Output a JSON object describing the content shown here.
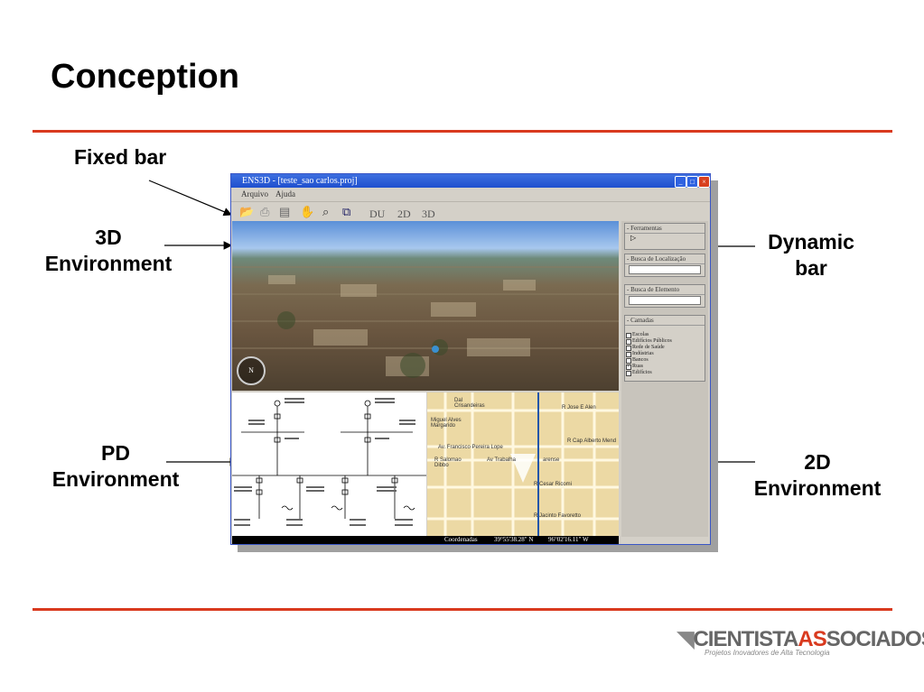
{
  "slide": {
    "title": "Conception",
    "callouts": {
      "fixed_bar": "Fixed bar",
      "env3d_line1": "3D",
      "env3d_line2": "Environment",
      "pd_line1": "PD",
      "pd_line2": "Environment",
      "dynamic_line1": "Dynamic",
      "dynamic_line2": "bar",
      "env2d_line1": "2D",
      "env2d_line2": "Environment"
    },
    "colors": {
      "accent": "#d93a1f",
      "window_title": "#2a5ad8"
    }
  },
  "app": {
    "title": "ENS3D - [teste_sao carlos.proj]",
    "menu": [
      "Arquivo",
      "Ajuda"
    ],
    "toolbar_text": [
      "DU",
      "2D",
      "3D"
    ],
    "toolbar_icons": [
      "folder-open-icon",
      "print-icon",
      "print-preview-icon",
      "hand-pan-icon",
      "zoom-icon",
      "select-icon"
    ],
    "dynamic_bar": {
      "ferramentas": "- Ferramentas",
      "busca_localizacao": "- Busca de Localização",
      "busca_elemento": "- Busca de Elemento",
      "camadas": "- Camadas",
      "layers": [
        {
          "label": "Escolas",
          "checked": false
        },
        {
          "label": "Edifícios Públicos",
          "checked": false
        },
        {
          "label": "Rede de Saúde",
          "checked": false
        },
        {
          "label": "Indústrias",
          "checked": false
        },
        {
          "label": "Bancos",
          "checked": false
        },
        {
          "label": "Ruas",
          "checked": true
        },
        {
          "label": "Edifícios",
          "checked": false
        }
      ]
    },
    "map_labels": {
      "street1": "R Jose E Alen",
      "street2": "Av. Francisco Pereira Lope",
      "street3": "R Cap Alberto Mend",
      "street4": "Av Trabalha",
      "street5": "R Salomao Dibbo",
      "street6": "R Cesar Ricomi",
      "street7": "R Jacinto Favoretto",
      "street8": "Dal Crisandeiras",
      "street9": "Miguel Alves Margarido",
      "street10": "arense"
    },
    "coords": {
      "label": "Coordenadas",
      "lat": "39°55'38.28\" N",
      "lon": "96°02'16.11\" W"
    }
  },
  "logo": {
    "name_part1": "CIENTISTA",
    "name_part2": "AS",
    "name_part3": "SOCIADOS",
    "tagline": "Projetos Inovadores de Alta Tecnologia"
  }
}
